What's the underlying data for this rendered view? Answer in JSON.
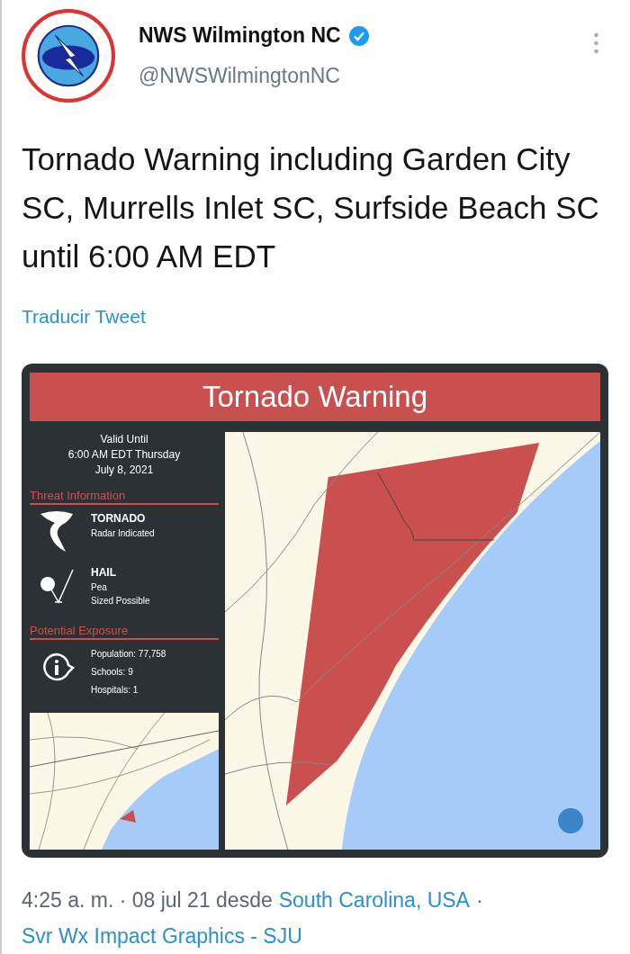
{
  "account": {
    "name": "NWS Wilmington NC",
    "verified": true,
    "handle": "@NWSWilmingtonNC"
  },
  "tweet": {
    "text": "Tornado Warning including Garden City SC, Murrells Inlet SC, Surfside Beach SC until 6:00 AM EDT",
    "translate": "Traducir Tweet"
  },
  "graphic": {
    "title": "Tornado Warning",
    "valid": [
      "Valid Until",
      "6:00 AM EDT Thursday",
      "July 8, 2021"
    ],
    "sections": [
      {
        "heading": "Threat Information",
        "items": [
          {
            "kind": "tornado",
            "lines": [
              "TORNADO",
              "Radar Indicated"
            ]
          },
          {
            "kind": "hail",
            "lines": [
              "HAIL",
              "Pea",
              "Sized Possible"
            ]
          }
        ]
      },
      {
        "heading": "Potential Exposure",
        "items": [
          {
            "kind": "info",
            "lines": [
              "Population: 77,758",
              "Schools: 9",
              "Hospitals: 1"
            ]
          }
        ]
      }
    ]
  },
  "footer": {
    "time": "4:25 a. m. · 08 jul 21 desde",
    "location": "South Carolina, USA",
    "separator": "·",
    "source": "Svr Wx Impact Graphics - SJU"
  }
}
